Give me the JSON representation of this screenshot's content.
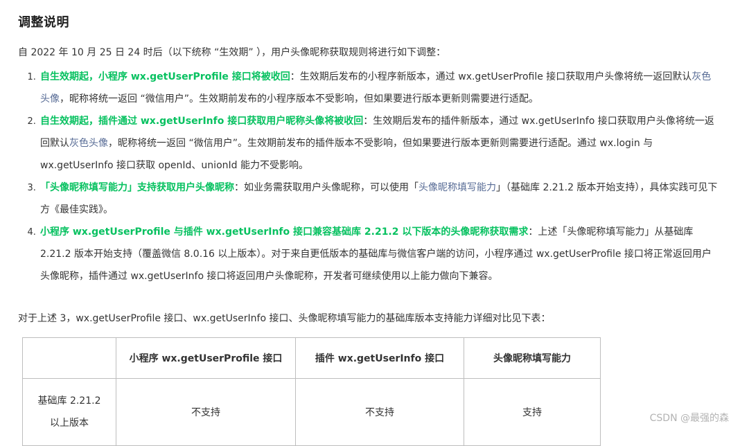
{
  "heading": "调整说明",
  "intro": "自 2022 年 10 月 25 日 24 时后（以下统称 “生效期” ），用户头像昵称获取规则将进行如下调整：",
  "rules": [
    {
      "bold": "自生效期起，小程序 wx.getUserProfile 接口将被收回",
      "pre_link": "：生效期后发布的小程序新版本，通过 wx.getUserProfile 接口获取用户头像将统一返回默认",
      "link": "灰色头像",
      "post_link": "，昵称将统一返回 “微信用户”。生效期前发布的小程序版本不受影响，但如果要进行版本更新则需要进行适配。"
    },
    {
      "bold": "自生效期起，插件通过 wx.getUserInfo 接口获取用户昵称头像将被收回",
      "pre_link": "：生效期后发布的插件新版本，通过 wx.getUserInfo 接口获取用户头像将统一返回默认",
      "link": "灰色头像",
      "post_link": "，昵称将统一返回 “微信用户”。生效期前发布的插件版本不受影响，但如果要进行版本更新则需要进行适配。通过 wx.login 与 wx.getUserInfo 接口获取 openId、unionId 能力不受影响。"
    },
    {
      "bold": "「头像昵称填写能力」支持获取用户头像昵称",
      "pre_link": "：如业务需获取用户头像昵称，可以使用「",
      "link": "头像昵称填写能力",
      "post_link": "」（基础库 2.21.2 版本开始支持），具体实践可见下方《最佳实践》。"
    },
    {
      "bold": "小程序 wx.getUserProfile 与插件 wx.getUserInfo 接口兼容基础库 2.21.2 以下版本的头像昵称获取需求",
      "pre_link": "：上述「头像昵称填写能力」从基础库 2.21.2 版本开始支持（覆盖微信 8.0.16 以上版本）。对于来自更低版本的基础库与微信客户端的访问，小程序通过 wx.getUserProfile 接口将正常返回用户头像昵称，插件通过 wx.getUserInfo 接口将返回用户头像昵称，开发者可继续使用以上能力做向下兼容。",
      "link": "",
      "post_link": ""
    }
  ],
  "compare_intro": "对于上述 3，wx.getUserProfile 接口、wx.getUserInfo 接口、头像昵称填写能力的基础库版本支持能力详细对比见下表：",
  "table": {
    "headers": [
      "",
      "小程序  wx.getUserProfile  接口",
      "插件 wx.getUserInfo  接口",
      "头像昵称填写能力"
    ],
    "row": {
      "label_line1": "基础库  2.21.2",
      "label_line2": "以上版本",
      "cells": [
        "不支持",
        "不支持",
        "支持"
      ]
    }
  },
  "watermark": "CSDN @最强的森",
  "colors": {
    "highlight": "#07c160",
    "link": "#576b95",
    "text": "#333333"
  }
}
